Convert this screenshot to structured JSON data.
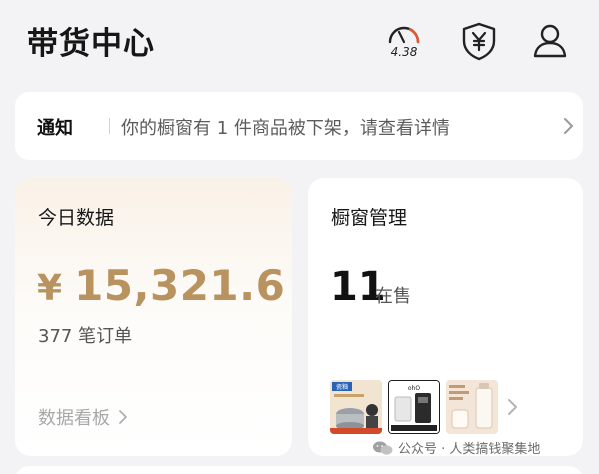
{
  "header": {
    "title": "带货中心",
    "speed_value": "4.38",
    "icons": [
      "speedometer-icon",
      "shield-yen-icon",
      "user-icon"
    ]
  },
  "notice": {
    "label": "通知",
    "text": "你的橱窗有 1 件商品被下架，请查看详情"
  },
  "today_data": {
    "title": "今日数据",
    "currency": "¥",
    "amount": "15,321.6",
    "orders": "377 笔订单",
    "dashboard_link": "数据看板"
  },
  "window_mgmt": {
    "title": "橱窗管理",
    "count": "11",
    "status": "在售",
    "thumb_texts": [
      "瓷釉",
      "ohO"
    ]
  },
  "watermark": {
    "text": "公众号 · 人类搞钱聚集地"
  },
  "colors": {
    "background": "#f3f3f5",
    "card": "#ffffff",
    "amount_gold": "#b8935f",
    "speed_arc_red": "#e8542e"
  }
}
